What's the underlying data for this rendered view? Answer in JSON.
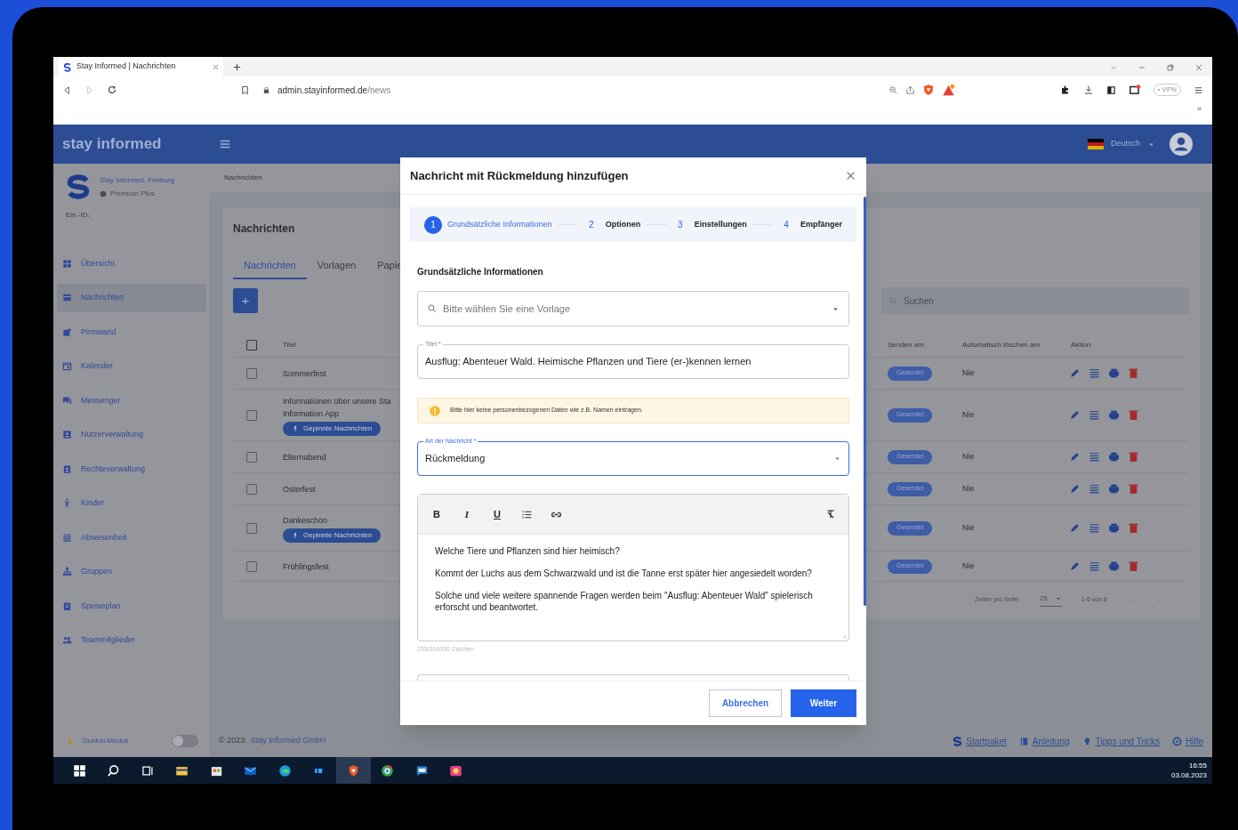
{
  "browser": {
    "tab_title": "Stay Informed | Nachrichten",
    "url_domain": "admin.stayinformed.de",
    "url_path": "/news",
    "vpn_label": "• VPN",
    "more": "»"
  },
  "app_header": {
    "brand": "stay informed",
    "language": "Deutsch"
  },
  "sidebar": {
    "org_name": "Stay Informed, Freiburg",
    "plan": "Premium Plus",
    "id_label": "Ein.-ID:",
    "items": [
      {
        "label": "Übersicht",
        "selected": false
      },
      {
        "label": "Nachrichten",
        "selected": true
      },
      {
        "label": "Pinnwand",
        "selected": false
      },
      {
        "label": "Kalender",
        "selected": false
      },
      {
        "label": "Messenger",
        "selected": false
      },
      {
        "label": "Nutzerverwaltung",
        "selected": false
      },
      {
        "label": "Rechteverwaltung",
        "selected": false
      },
      {
        "label": "Kinder",
        "selected": false
      },
      {
        "label": "Abwesenheit",
        "selected": false
      },
      {
        "label": "Gruppen",
        "selected": false
      },
      {
        "label": "Speiseplan",
        "selected": false
      },
      {
        "label": "Teammitglieder",
        "selected": false
      }
    ],
    "dark_mode": {
      "label": "Dunkel-Modus",
      "on": false
    }
  },
  "breadcrumb": "Nachrichten",
  "card": {
    "title": "Nachrichten",
    "tabs": [
      {
        "label": "Nachrichten",
        "selected": true
      },
      {
        "label": "Vorlagen",
        "selected": false
      },
      {
        "label": "Papie",
        "selected": false
      }
    ],
    "add_button": "+",
    "search_placeholder": "Suchen",
    "select_all_checked": false,
    "columns": {
      "title": "Titel",
      "send": "Senden am",
      "delete": "Automatisch löschen am",
      "action": "Aktion"
    },
    "rows": [
      {
        "title_lines": [
          "Sommerfest"
        ],
        "checked": false,
        "status": "Gesendet",
        "auto_delete": "Nie"
      },
      {
        "title_lines": [
          "Informationen über unsere Sta",
          "Information App"
        ],
        "badge": "Gepinnte Nachrichten",
        "checked": false,
        "status": "Gesendet",
        "auto_delete": "Nie"
      },
      {
        "title_lines": [
          "Elternabend"
        ],
        "checked": false,
        "status": "Gesendet",
        "auto_delete": "Nie"
      },
      {
        "title_lines": [
          "Osterfest"
        ],
        "checked": false,
        "status": "Gesendet",
        "auto_delete": "Nie"
      },
      {
        "title_lines": [
          "Dankeschön"
        ],
        "badge": "Gepinnte Nachrichten",
        "checked": false,
        "status": "Gesendet",
        "auto_delete": "Nie"
      },
      {
        "title_lines": [
          "Frühlingsfest"
        ],
        "checked": false,
        "status": "Gesendet",
        "auto_delete": "Nie"
      }
    ],
    "pagination": {
      "rows_label": "Zeilen pro Seite:",
      "rows_value": "25",
      "range": "1-6 von 6"
    }
  },
  "footer": {
    "copyright": "© 2023.",
    "company": "Stay Informed GmbH",
    "links": [
      "Startpaket",
      "Anleitung",
      "Tipps und Tricks",
      "Hilfe"
    ]
  },
  "modal": {
    "title": "Nachricht mit Rückmeldung hinzufügen",
    "steps": [
      {
        "number": "1",
        "label": "Grundsätzliche Informationen",
        "selected": true
      },
      {
        "number": "2",
        "label": "Optionen",
        "selected": false
      },
      {
        "number": "3",
        "label": "Einstellungen",
        "selected": false
      },
      {
        "number": "4",
        "label": "Empfänger",
        "selected": false
      }
    ],
    "section_heading": "Grundsätzliche Informationen",
    "template_placeholder": "Bitte wählen Sie eine Vorlage",
    "title_field": {
      "label": "Titel *",
      "value": "Ausflug: Abenteuer Wald. Heimische Pflanzen und Tiere (er-)kennen  lernen"
    },
    "warning": "Bitte hier keine personenbezogenen Daten wie z.B. Namen eintragen.",
    "type_field": {
      "label": "Art der Nachricht *",
      "value": "Rückmeldung"
    },
    "editor": {
      "toolbar": [
        "B",
        "I",
        "U"
      ],
      "paragraphs": [
        "Welche Tiere und Pflanzen sind hier heimisch?",
        "Kommt der Luchs aus dem Schwarzwald und ist die Tanne erst später hier angesiedelt worden?",
        "Solche und viele weitere spannende Fragen werden beim \"Ausflug: Abenteuer Wald\" spielerisch erforscht und beantwortet."
      ],
      "counter": "253/300000 Zeichen"
    },
    "buttons": {
      "cancel": "Abbrechen",
      "next": "Weiter"
    }
  },
  "taskbar": {
    "time": "16:55",
    "date": "03.08.2023"
  }
}
